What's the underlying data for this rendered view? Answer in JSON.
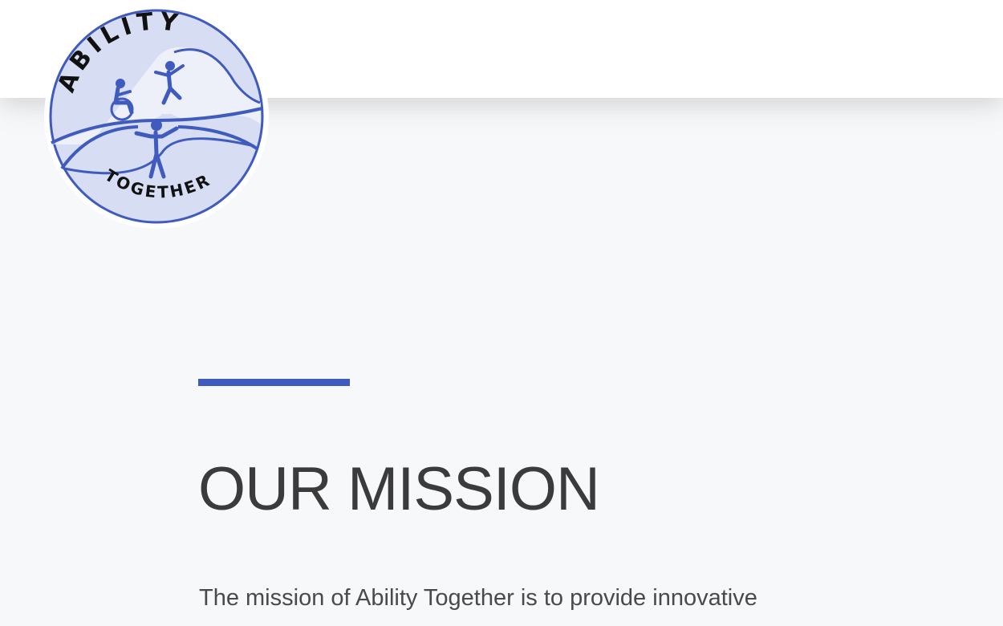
{
  "brand": {
    "logo_top_text": "ABILITY",
    "logo_bottom_text": "TOGETHER",
    "primary_color": "#3f5bbd",
    "logo_fill_color": "#d7ddf2"
  },
  "header": {
    "background_color": "#ffffff"
  },
  "mission": {
    "heading": "OUR MISSION",
    "text": "The mission of Ability Together is to provide innovative",
    "accent_color": "#3f5bbd"
  },
  "page": {
    "background_color": "#f7f8fa"
  }
}
